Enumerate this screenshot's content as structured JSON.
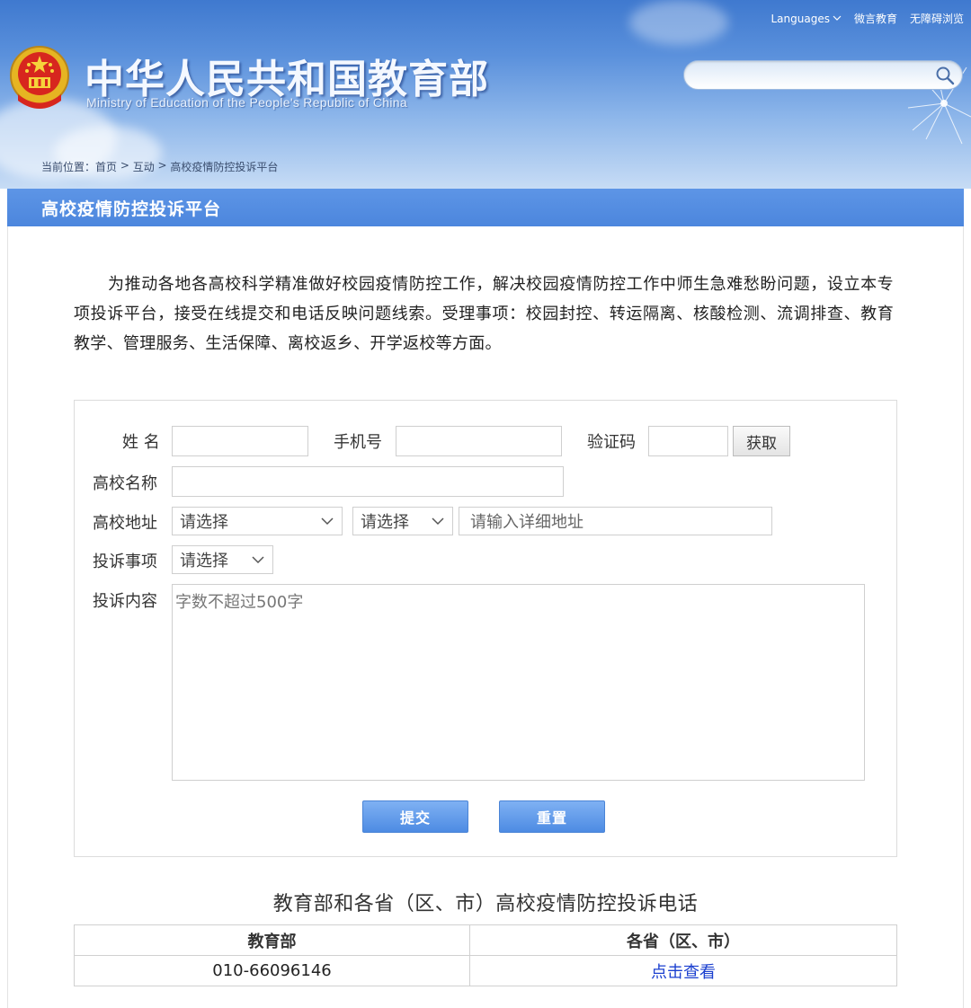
{
  "header": {
    "title": "中华人民共和国教育部",
    "subtitle": "Ministry of Education of the People's Republic of China",
    "top_links": {
      "languages": "Languages",
      "weiyan": "微言教育",
      "accessible": "无障碍浏览"
    },
    "search": {
      "value": ""
    },
    "breadcrumb": {
      "prefix": "当前位置：",
      "home": "首页",
      "sep1": " > ",
      "interact": "互动",
      "sep2": " > ",
      "current": "高校疫情防控投诉平台"
    }
  },
  "section": {
    "title": "高校疫情防控投诉平台"
  },
  "intro": "为推动各地各高校科学精准做好校园疫情防控工作，解决校园疫情防控工作中师生急难愁盼问题，设立本专项投诉平台，接受在线提交和电话反映问题线索。受理事项：校园封控、转运隔离、核酸检测、流调排查、教育教学、管理服务、生活保障、离校返乡、开学返校等方面。",
  "form": {
    "name_label": "姓 名",
    "phone_label": "手机号",
    "code_label": "验证码",
    "get_code": "获取",
    "school_label": "高校名称",
    "address_label": "高校地址",
    "province_select": "请选择",
    "city_select": "请选择",
    "address_placeholder": "请输入详细地址",
    "matter_label": "投诉事项",
    "matter_select": "请选择",
    "content_label": "投诉内容",
    "content_placeholder": "字数不超过500字",
    "submit": "提交",
    "reset": "重置"
  },
  "phone_section": {
    "title": "教育部和各省（区、市）高校疫情防控投诉电话",
    "headers": [
      "教育部",
      "各省（区、市）"
    ],
    "moe_phone": "010-66096146",
    "province_link": "点击查看"
  },
  "colors": {
    "header_blue": "#4a84d6",
    "section_bar": "#5590e2",
    "button_blue": "#5f9ae8",
    "link_blue": "#1a3fcf"
  }
}
